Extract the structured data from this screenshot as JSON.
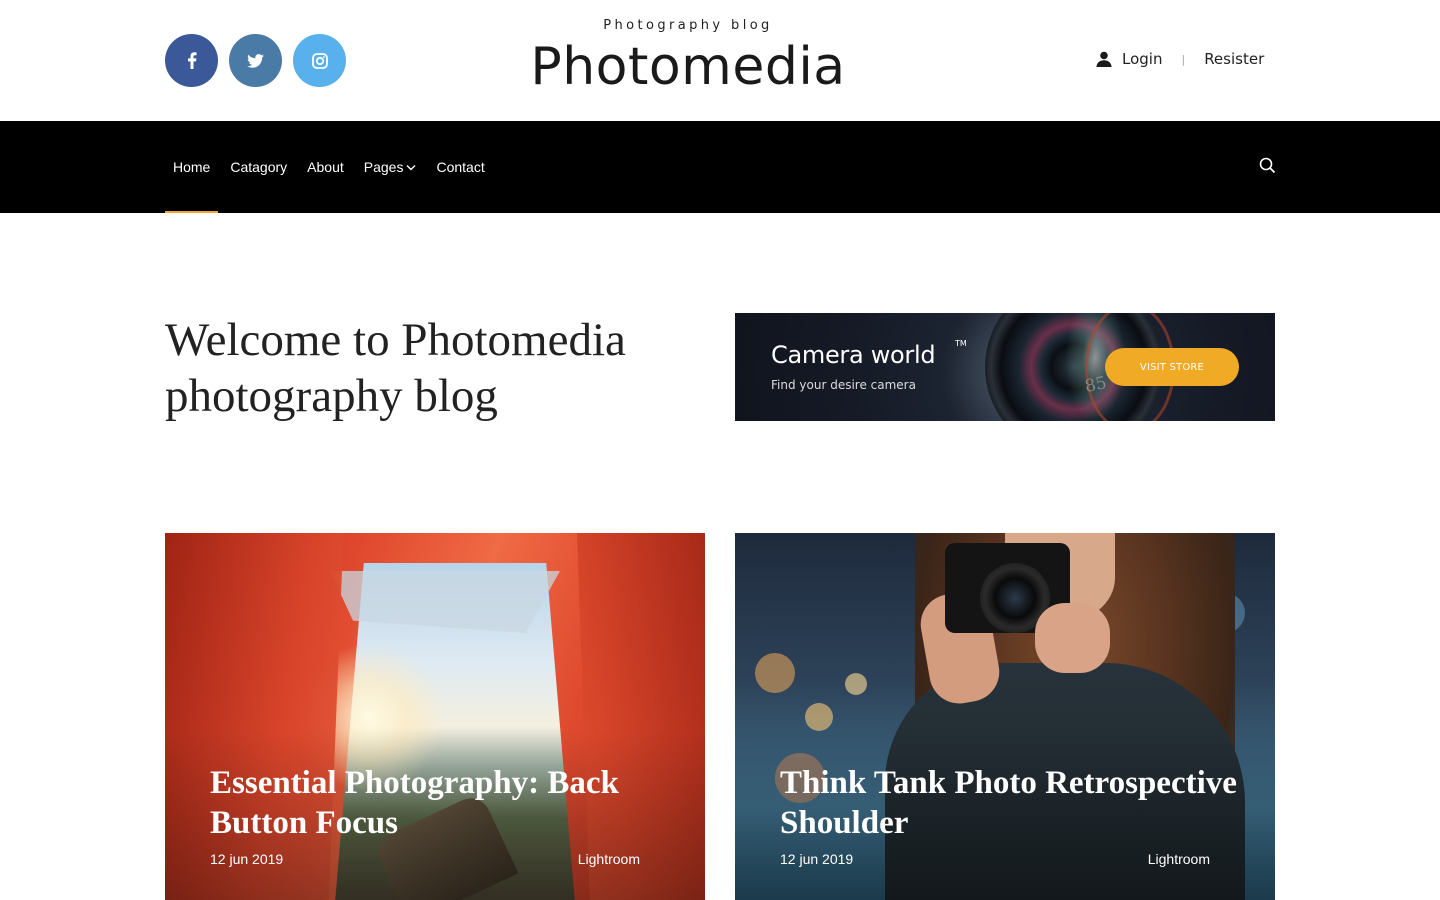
{
  "header": {
    "tagline": "Photography blog",
    "logo": "Photomedia",
    "social": [
      {
        "icon": "facebook-icon",
        "color": "#3b5998"
      },
      {
        "icon": "twitter-icon",
        "color": "#4a7aa6"
      },
      {
        "icon": "instagram-icon",
        "color": "#58b0ec"
      }
    ],
    "login_label": "Login",
    "separator": "|",
    "register_label": "Resister"
  },
  "nav": {
    "items": [
      {
        "label": "Home",
        "active": true
      },
      {
        "label": "Catagory"
      },
      {
        "label": "About"
      },
      {
        "label": "Pages",
        "dropdown": true
      },
      {
        "label": "Contact"
      }
    ],
    "search_icon": "search-icon",
    "active_color": "#f0a830"
  },
  "hero": {
    "title": "Welcome to Photomedia photography blog"
  },
  "banner": {
    "title": "Camera world",
    "trademark": "TM",
    "subtitle": "Find your desire camera",
    "lens_number": "85",
    "button_label": "VISIT STORE",
    "button_color": "#f0aa26"
  },
  "posts": [
    {
      "title": "Essential Photography: Back Button Focus",
      "date": "12 jun 2019",
      "category": "Lightroom"
    },
    {
      "title": "Think Tank Photo Retrospective Shoulder",
      "date": "12 jun 2019",
      "category": "Lightroom"
    }
  ]
}
